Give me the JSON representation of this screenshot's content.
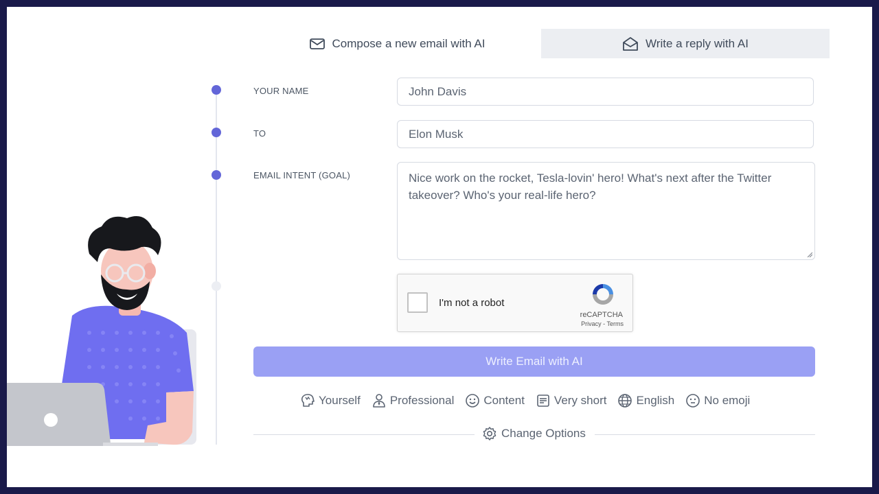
{
  "tabs": {
    "compose": {
      "label": "Compose a new email with AI",
      "icon": "envelope-icon"
    },
    "reply": {
      "label": "Write a reply with AI",
      "icon": "envelope-open-icon"
    }
  },
  "form": {
    "name": {
      "label": "YOUR NAME",
      "value": "John Davis"
    },
    "to": {
      "label": "TO",
      "value": "Elon Musk"
    },
    "intent": {
      "label": "EMAIL INTENT (GOAL)",
      "value": "Nice work on the rocket, Tesla-lovin' hero! What's next after the Twitter takeover? Who's your real-life hero?"
    }
  },
  "captcha": {
    "label": "I'm not a robot",
    "brand": "reCAPTCHA",
    "links": "Privacy - Terms"
  },
  "submit_label": "Write Email with AI",
  "options": [
    {
      "label": "Yourself",
      "icon": "head-icon"
    },
    {
      "label": "Professional",
      "icon": "person-tie-icon"
    },
    {
      "label": "Content",
      "icon": "smile-icon"
    },
    {
      "label": "Very short",
      "icon": "document-icon"
    },
    {
      "label": "English",
      "icon": "globe-icon"
    },
    {
      "label": "No emoji",
      "icon": "neutral-face-icon"
    }
  ],
  "change_options_label": "Change Options",
  "colors": {
    "accent": "#6366d8",
    "button": "#9aa0f4",
    "shirt": "#6f6ef0",
    "frame": "#1a1a4a"
  }
}
